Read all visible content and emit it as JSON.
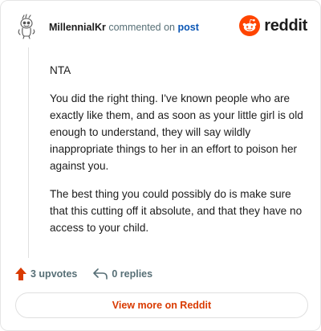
{
  "header": {
    "author": "MillennialKr",
    "verb": "commented on",
    "post_link": "post"
  },
  "brand": {
    "name": "reddit",
    "logo_icon": "reddit-logo-icon",
    "color": "#ff4500"
  },
  "comment": {
    "paragraphs": [
      "NTA",
      "You did the right thing. I've known people who are exactly like them, and as soon as your little girl is old enough to understand, they will say wildly inappropriate things to her in an effort to poison her against you.",
      "The best thing you could possibly do is make sure that this cutting off it absolute, and that they have no access to your child."
    ]
  },
  "actions": {
    "upvotes": "3 upvotes",
    "upvote_icon": "upvote-arrow-icon",
    "upvote_color": "#d93a00",
    "replies": "0 replies",
    "reply_icon": "reply-arrow-icon"
  },
  "footer": {
    "view_more": "View more on Reddit",
    "accent": "#d93a00"
  }
}
